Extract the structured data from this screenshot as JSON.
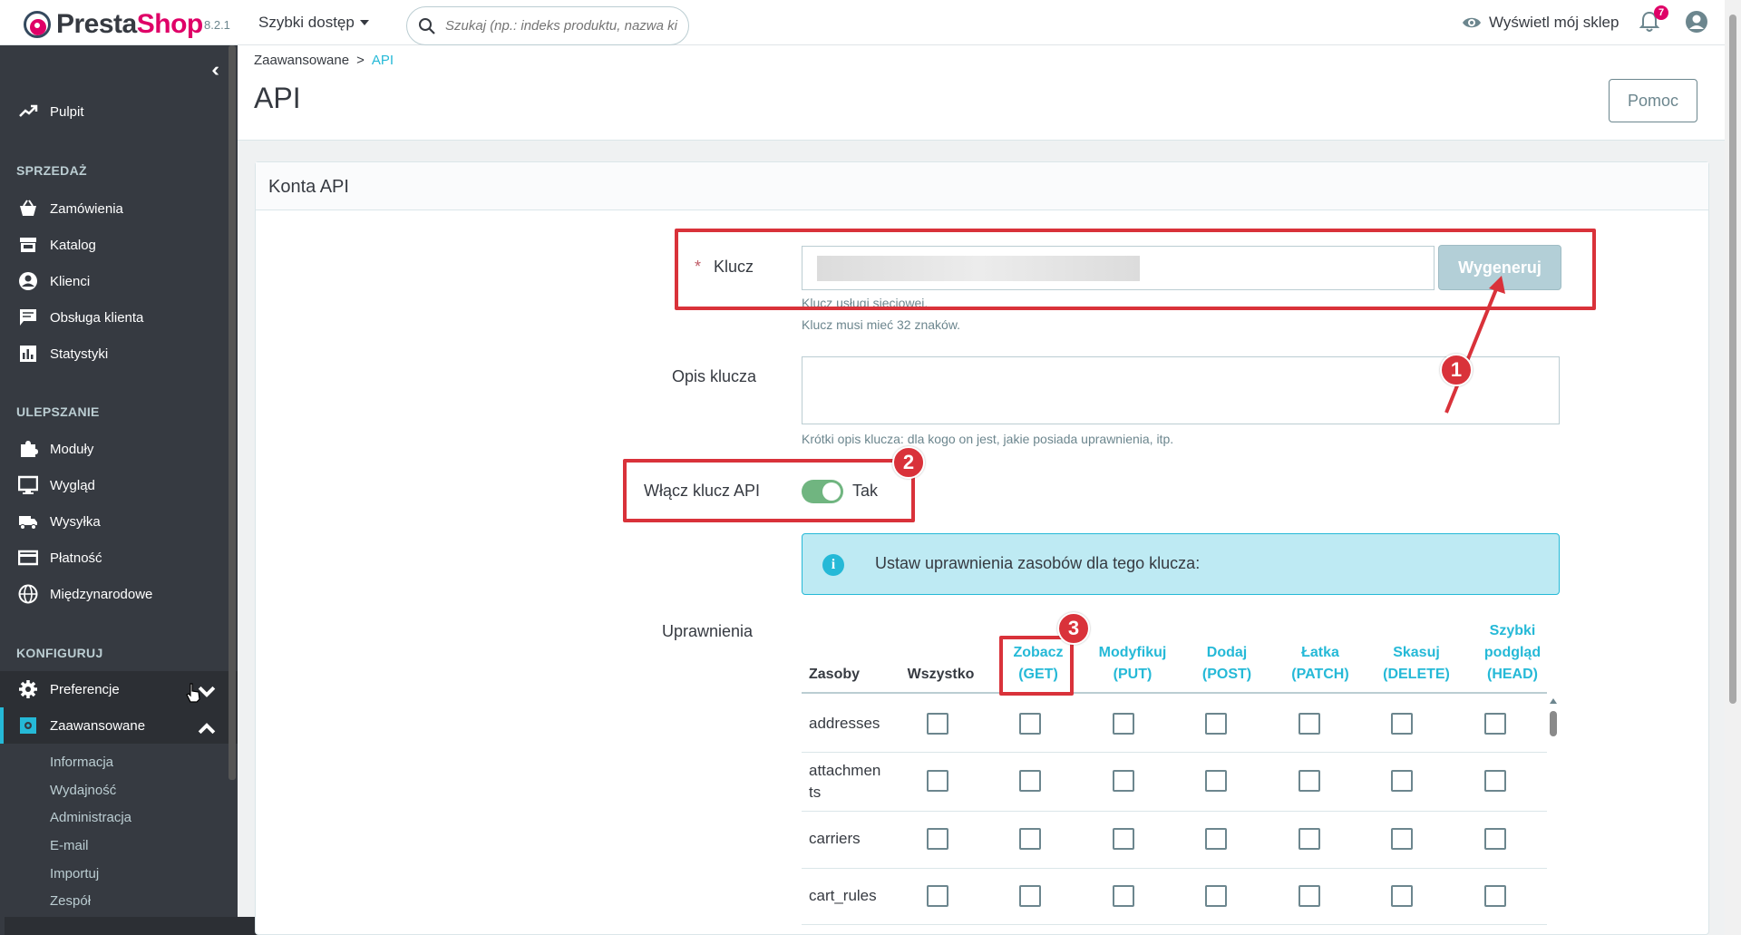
{
  "header": {
    "logo_part1": "Presta",
    "logo_part2": "Shop",
    "version": "8.2.1",
    "quick_access": "Szybki dostęp",
    "search_placeholder": "Szukaj (np.: indeks produktu, nazwa ki",
    "view_shop": "Wyświetl mój sklep",
    "notifications_count": "7"
  },
  "sidebar": {
    "dashboard": "Pulpit",
    "section_sales": "SPRZEDAŻ",
    "orders": "Zamówienia",
    "catalog": "Katalog",
    "customers": "Klienci",
    "customer_service": "Obsługa klienta",
    "stats": "Statystyki",
    "section_improve": "ULEPSZANIE",
    "modules": "Moduły",
    "design": "Wygląd",
    "shipping": "Wysyłka",
    "payment": "Płatność",
    "international": "Międzynarodowe",
    "section_configure": "KONFIGURUJ",
    "preferences": "Preferencje",
    "advanced": "Zaawansowane",
    "sub": [
      "Informacja",
      "Wydajność",
      "Administracja",
      "E-mail",
      "Importuj",
      "Zespół"
    ]
  },
  "breadcrumb": {
    "parent": "Zaawansowane",
    "sep": ">",
    "current": "API"
  },
  "page_title": "API",
  "help_button": "Pomoc",
  "card": {
    "title": "Konta API",
    "key_label": "Klucz",
    "required_mark": "*",
    "generate_button": "Wygeneruj",
    "key_hint1": "Klucz usługi sieciowej.",
    "key_hint2": "Klucz musi mieć 32 znaków.",
    "desc_label": "Opis klucza",
    "desc_hint": "Krótki opis klucza: dla kogo on jest, jakie posiada uprawnienia, itp.",
    "enable_label": "Włącz klucz API",
    "enable_value": "Tak",
    "info_text": "Ustaw uprawnienia zasobów dla tego klucza:",
    "permissions_label": "Uprawnienia",
    "columns": {
      "resources": "Zasoby",
      "all": "Wszystko",
      "get1": "Zobacz",
      "get2": "(GET)",
      "put1": "Modyfikuj",
      "put2": "(PUT)",
      "post1": "Dodaj",
      "post2": "(POST)",
      "patch1": "Łatka",
      "patch2": "(PATCH)",
      "delete1": "Skasuj",
      "delete2": "(DELETE)",
      "head1": "Szybki",
      "head2": "podgląd",
      "head3": "(HEAD)"
    },
    "rows": [
      "addresses",
      "attachmen",
      "ts",
      "carriers",
      "cart_rules"
    ]
  },
  "annotations": [
    "1",
    "2",
    "3"
  ],
  "colors": {
    "accent": "#25b9d7",
    "brand": "#df0067",
    "annotation": "#d9323a",
    "switch_on": "#70b580"
  }
}
